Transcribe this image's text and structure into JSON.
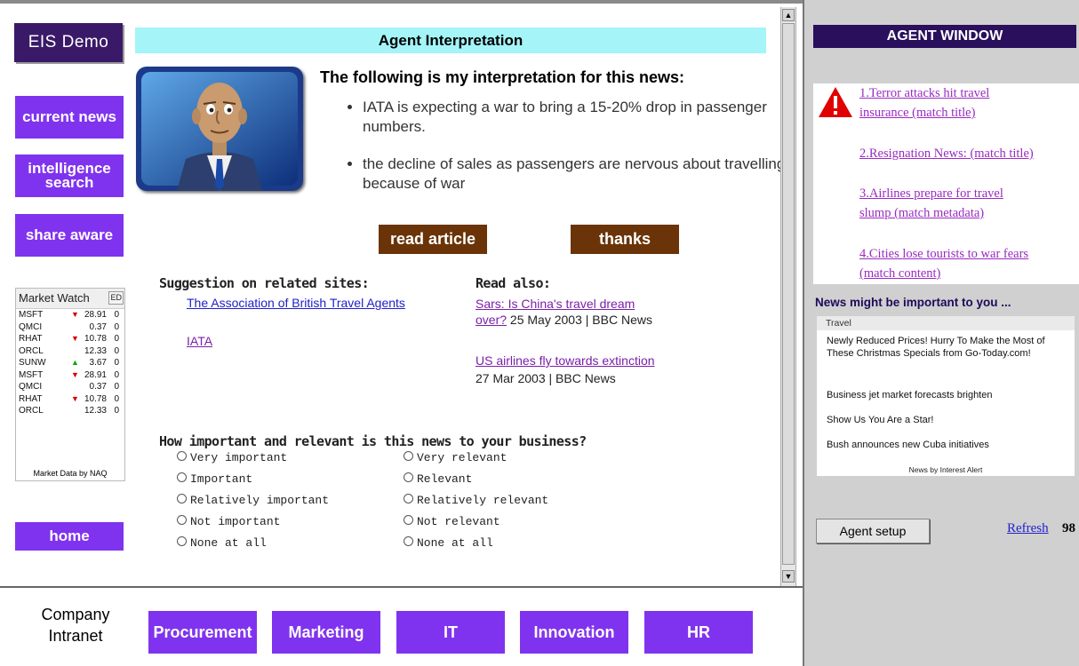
{
  "logo": "EIS Demo",
  "nav": {
    "current_news": "current news",
    "intelligence_search": "intelligence search",
    "share_aware": "share aware",
    "home": "home"
  },
  "market_watch": {
    "title": "Market Watch",
    "edit_label": "ED",
    "rows": [
      {
        "symbol": "MSFT",
        "direction": "down",
        "price": "28.91",
        "change": "0"
      },
      {
        "symbol": "QMCI",
        "direction": "none",
        "price": "0.37",
        "change": "0"
      },
      {
        "symbol": "RHAT",
        "direction": "down",
        "price": "10.78",
        "change": "0"
      },
      {
        "symbol": "ORCL",
        "direction": "none",
        "price": "12.33",
        "change": "0"
      },
      {
        "symbol": "SUNW",
        "direction": "up",
        "price": "3.67",
        "change": "0"
      },
      {
        "symbol": "MSFT",
        "direction": "down",
        "price": "28.91",
        "change": "0"
      },
      {
        "symbol": "QMCI",
        "direction": "none",
        "price": "0.37",
        "change": "0"
      },
      {
        "symbol": "RHAT",
        "direction": "down",
        "price": "10.78",
        "change": "0"
      },
      {
        "symbol": "ORCL",
        "direction": "none",
        "price": "12.33",
        "change": "0"
      }
    ],
    "footer": "Market Data by NAQ"
  },
  "interpretation": {
    "header": "Agent Interpretation",
    "title": "The following is my interpretation for this news:",
    "bullets": [
      "IATA is expecting a war to bring a 15-20% drop in passenger numbers.",
      "the decline of sales as passengers are nervous about travelling because of war"
    ],
    "read_article": "read article",
    "thanks": "thanks"
  },
  "related_sites": {
    "title": "Suggestion on related sites:",
    "links": [
      "The Association of British Travel Agents",
      "IATA"
    ]
  },
  "read_also": {
    "title": "Read also:",
    "items": [
      {
        "link_line1": "Sars: Is China's travel dream",
        "link_line2": "over?",
        "source": " 25 May 2003 | BBC News"
      },
      {
        "link": "US airlines fly towards extinction",
        "source": "27 Mar 2003 | BBC News"
      }
    ]
  },
  "survey": {
    "question": "How important and relevant is this news to your business?",
    "importance": [
      "Very important",
      "Important",
      "Relatively important",
      "Not important",
      "None at all"
    ],
    "relevance": [
      "Very relevant",
      "Relevant",
      "Relatively relevant",
      "Not relevant",
      "None at all"
    ]
  },
  "intranet": {
    "label_line1": "Company",
    "label_line2": "Intranet",
    "departments": [
      "Procurement",
      "Marketing",
      "IT",
      "Innovation",
      "HR"
    ]
  },
  "agent_window": {
    "title": "AGENT WINDOW",
    "alerts": [
      {
        "line1": "1.Terror attacks hit travel",
        "line2": "insurance (match title)"
      },
      {
        "line1": "2.Resignation News: (match title)",
        "line2": ""
      },
      {
        "line1": "3.Airlines prepare for travel",
        "line2": "slump (match metadata)"
      },
      {
        "line1": "4.Cities lose tourists to war fears",
        "line2": "(match content)"
      }
    ],
    "news_title": "News might be important to you ...",
    "news_category": "Travel",
    "news_items": [
      "Newly Reduced Prices! Hurry To Make the Most of These Christmas Specials from Go-Today.com!",
      "Business jet market forecasts brighten",
      "Show Us You Are a Star!",
      "Bush announces new Cuba initiatives"
    ],
    "news_footer": "News by Interest Alert",
    "setup_button": "Agent setup",
    "refresh_link": "Refresh",
    "refresh_value": "98"
  },
  "colors": {
    "nav_purple": "#8033ee",
    "logo_dark": "#3a1a68",
    "header_cyan": "#a4f4f8",
    "button_brown": "#6a3408",
    "alert_red": "#e00000",
    "link_purple": "#7a1fa8"
  }
}
